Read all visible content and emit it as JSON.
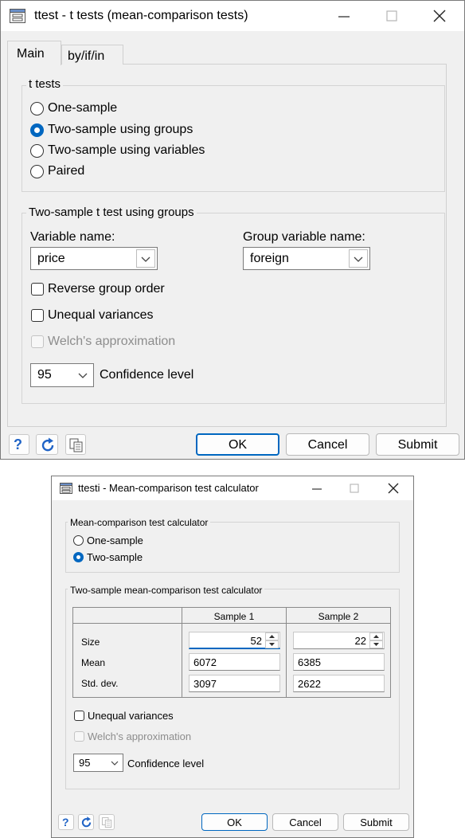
{
  "dialog1": {
    "title": "ttest - t tests (mean-comparison tests)",
    "tabs": [
      "Main",
      "by/if/in"
    ],
    "ttests_group": {
      "title": "t tests",
      "options": [
        "One-sample",
        "Two-sample using groups",
        "Two-sample using variables",
        "Paired"
      ],
      "selected": "Two-sample using groups"
    },
    "twosample_group": {
      "title": "Two-sample t test using groups",
      "variable_label": "Variable name:",
      "variable_value": "price",
      "group_label": "Group variable name:",
      "group_value": "foreign",
      "reverse_label": "Reverse group order",
      "unequal_label": "Unequal variances",
      "welch_label": "Welch's approximation",
      "confidence_value": "95",
      "confidence_label": "Confidence level"
    },
    "buttons": {
      "ok": "OK",
      "cancel": "Cancel",
      "submit": "Submit"
    }
  },
  "dialog2": {
    "title": "ttesti - Mean-comparison test calculator",
    "calc_group": {
      "title": "Mean-comparison test calculator",
      "options": [
        "One-sample",
        "Two-sample"
      ],
      "selected": "Two-sample"
    },
    "twosample_group": {
      "title": "Two-sample mean-comparison test calculator",
      "columns": [
        "Sample 1",
        "Sample 2"
      ],
      "rows": [
        "Size",
        "Mean",
        "Std. dev."
      ],
      "sample1": {
        "size": "52",
        "mean": "6072",
        "sd": "3097"
      },
      "sample2": {
        "size": "22",
        "mean": "6385",
        "sd": "2622"
      },
      "unequal_label": "Unequal variances",
      "welch_label": "Welch's approximation",
      "confidence_value": "95",
      "confidence_label": "Confidence level"
    },
    "buttons": {
      "ok": "OK",
      "cancel": "Cancel",
      "submit": "Submit"
    }
  },
  "colors": {
    "accent": "#0067c0",
    "background": "#f0f0f0"
  },
  "icons": [
    "dialog-icon",
    "minimize-icon",
    "maximize-icon",
    "close-icon",
    "help-icon",
    "reset-icon",
    "copy-icon",
    "chevron-down-icon",
    "spin-up-icon",
    "spin-down-icon"
  ]
}
